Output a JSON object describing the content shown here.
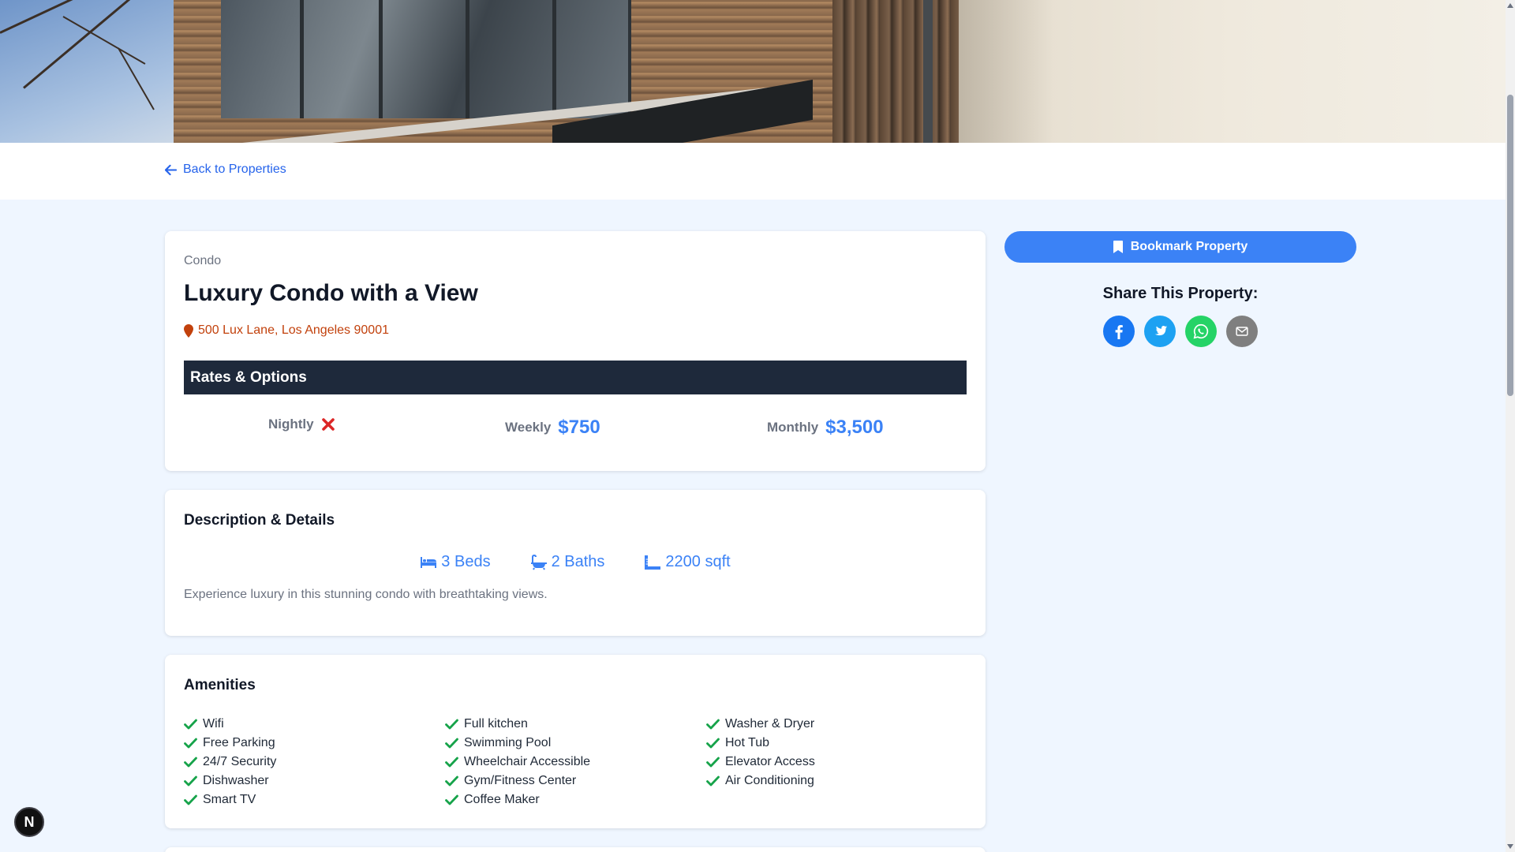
{
  "nav": {
    "back_label": "Back to Properties"
  },
  "property": {
    "type": "Condo",
    "name": "Luxury Condo with a View",
    "address": "500 Lux Lane, Los Angeles 90001"
  },
  "rates": {
    "header": "Rates & Options",
    "items": [
      {
        "label": "Nightly",
        "value": null,
        "available": false
      },
      {
        "label": "Weekly",
        "value": "$750",
        "available": true
      },
      {
        "label": "Monthly",
        "value": "$3,500",
        "available": true
      }
    ]
  },
  "details": {
    "title": "Description & Details",
    "beds": "3 Beds",
    "baths": "2 Baths",
    "sqft": "2200 sqft",
    "description": "Experience luxury in this stunning condo with breathtaking views."
  },
  "amenities": {
    "title": "Amenities",
    "items": [
      "Wifi",
      "Free Parking",
      "24/7 Security",
      "Dishwasher",
      "Smart TV",
      "Full kitchen",
      "Swimming Pool",
      "Wheelchair Accessible",
      "Gym/Fitness Center",
      "Coffee Maker",
      "Washer & Dryer",
      "Hot Tub",
      "Elevator Access",
      "Air Conditioning"
    ]
  },
  "sidebar": {
    "bookmark_label": "Bookmark Property",
    "share_title": "Share This Property:",
    "share_buttons": [
      {
        "name": "facebook",
        "color": "#1877f2"
      },
      {
        "name": "twitter",
        "color": "#1da1f2"
      },
      {
        "name": "whatsapp",
        "color": "#25d366"
      },
      {
        "name": "email",
        "color": "#7f7f7f"
      }
    ]
  },
  "dev_badge": "N",
  "colors": {
    "accent": "#3b82f6",
    "link": "#2563eb",
    "address": "#c2410c",
    "header_bg": "#1e293b",
    "check": "#16a34a",
    "unavailable": "#dc2626"
  }
}
